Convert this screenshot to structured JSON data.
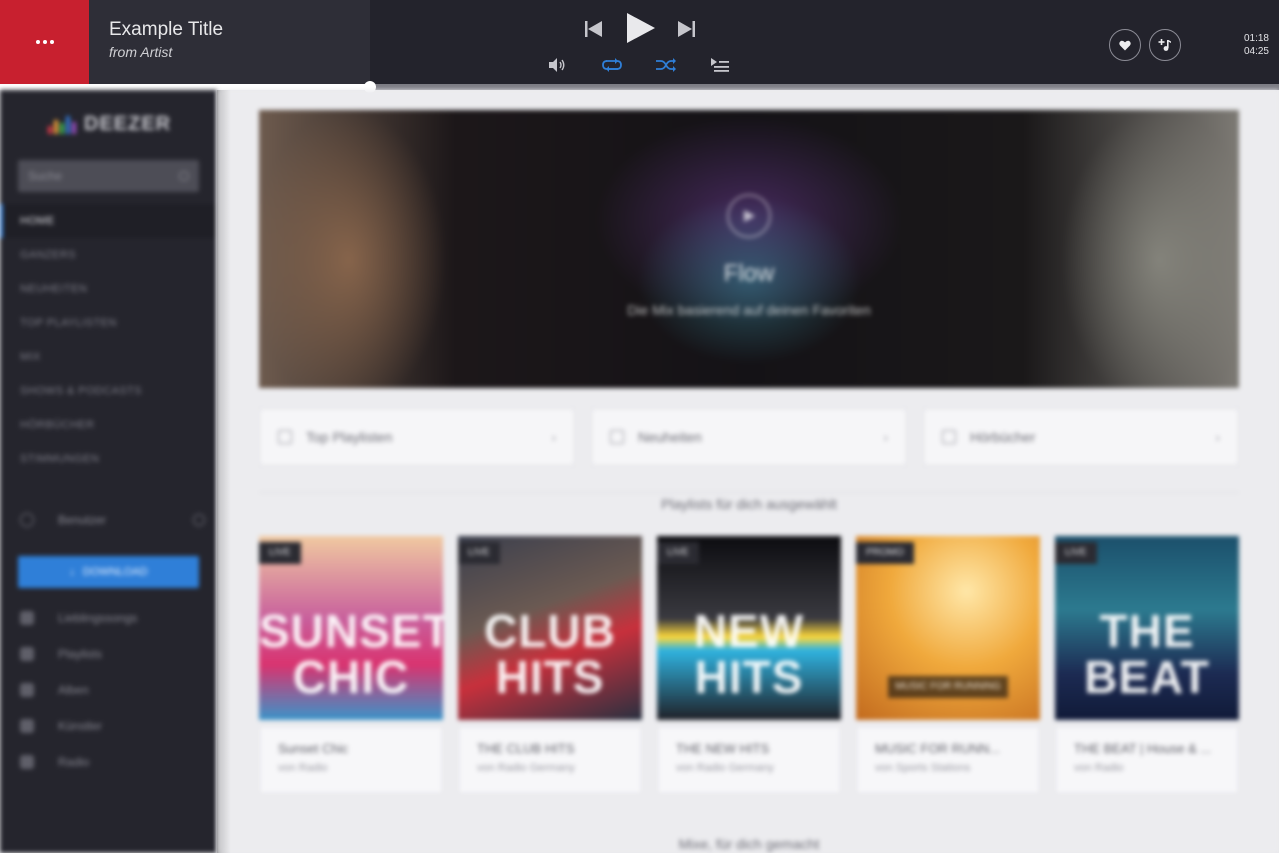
{
  "player": {
    "track_title": "Example Title",
    "track_artist": "from Artist",
    "time_elapsed": "01:18",
    "time_total": "04:25",
    "progress_fraction": 0.289,
    "accent_color": "#c8202f",
    "active_control_color": "#2f7fd8",
    "icons": [
      "more-icon",
      "previous-icon",
      "play-icon",
      "next-icon",
      "volume-icon",
      "repeat-icon",
      "shuffle-icon",
      "queue-icon",
      "heart-icon",
      "add-to-playlist-icon"
    ]
  },
  "sidebar": {
    "search_placeholder": "Suche",
    "nav": [
      {
        "label": "Home",
        "active": true
      },
      {
        "label": "Ganzers"
      },
      {
        "label": "Neuheiten"
      },
      {
        "label": "Top Playlisten"
      },
      {
        "label": "Mix"
      },
      {
        "label": "Shows & Podcasts"
      },
      {
        "label": "Hörbücher"
      },
      {
        "label": "Stimmungen"
      }
    ],
    "user_name": "Benutzer",
    "download_label": "Download",
    "library": [
      {
        "label": "Lieblingssongs",
        "icon": "heart-icon"
      },
      {
        "label": "Playlists",
        "icon": "playlist-icon"
      },
      {
        "label": "Alben",
        "icon": "album-icon"
      },
      {
        "label": "Künstler",
        "icon": "artist-icon"
      },
      {
        "label": "Radio",
        "icon": "radio-icon"
      }
    ]
  },
  "main": {
    "hero": {
      "title": "Flow",
      "subtitle": "Die Mix basierend auf deinen Favoriten"
    },
    "quick_links": [
      {
        "label": "Top Playlisten",
        "icon": "list-icon"
      },
      {
        "label": "Neuheiten",
        "icon": "new-icon"
      },
      {
        "label": "Hörbücher",
        "icon": "book-icon"
      }
    ],
    "section1_title": "Playlists für dich ausgewählt",
    "section2_title": "Mixe, für dich gemacht",
    "cards": [
      {
        "badge": "LIVE",
        "cover_text": "SUNSET CHIC",
        "title": "Sunset Chic",
        "sub": "von Radio"
      },
      {
        "badge": "LIVE",
        "cover_text": "CLUB HITS",
        "title": "THE CLUB HITS",
        "sub": "von Radio Germany"
      },
      {
        "badge": "LIVE",
        "cover_text": "NEW HITS",
        "title": "THE NEW HITS",
        "sub": "von Radio Germany"
      },
      {
        "badge": "PROMO",
        "cover_text": "",
        "cover_tag": "MUSIC FOR RUNNING",
        "title": "MUSIC FOR RUNN...",
        "sub": "von Sports Stations"
      },
      {
        "badge": "LIVE",
        "cover_text": "THE BEAT",
        "title": "THE BEAT | House & ...",
        "sub": "von Radio"
      }
    ]
  }
}
